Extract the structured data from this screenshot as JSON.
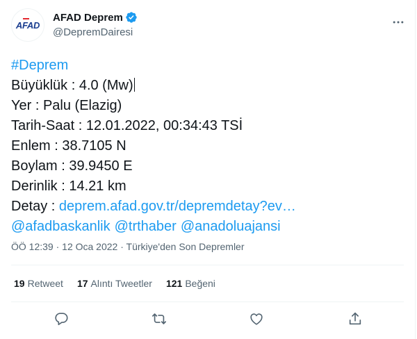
{
  "account": {
    "display_name": "AFAD Deprem",
    "handle": "@DepremDairesi",
    "avatar_text": "AFAD"
  },
  "tweet": {
    "hashtag": "#Deprem",
    "lines": [
      "Büyüklük : 4.0 (Mw)",
      "Yer : Palu (Elazig)",
      "Tarih-Saat : 12.01.2022, 00:34:43 TSİ",
      "Enlem : 38.7105 N",
      "Boylam : 39.9450 E",
      "Derinlik : 14.21 km"
    ],
    "detail_label": "Detay : ",
    "detail_link": "deprem.afad.gov.tr/depremdetay?ev…",
    "mentions": [
      "@afadbaskanlik",
      "@trthaber",
      "@anadoluajansi"
    ]
  },
  "meta": {
    "time": "ÖÖ 12:39",
    "sep": " · ",
    "date": "12 Oca 2022",
    "source": "Türkiye'den Son Depremler"
  },
  "stats": {
    "retweets_count": "19",
    "retweets_label": "Retweet",
    "quotes_count": "17",
    "quotes_label": "Alıntı Tweetler",
    "likes_count": "121",
    "likes_label": "Beğeni"
  },
  "icons": {
    "verified": "verified-badge-icon",
    "more": "more-icon",
    "reply": "reply-icon",
    "retweet": "retweet-icon",
    "like": "heart-icon",
    "share": "share-icon"
  },
  "colors": {
    "link": "#1d9bf0",
    "text": "#0f1419",
    "secondary": "#536471",
    "divider": "#eff3f4"
  }
}
